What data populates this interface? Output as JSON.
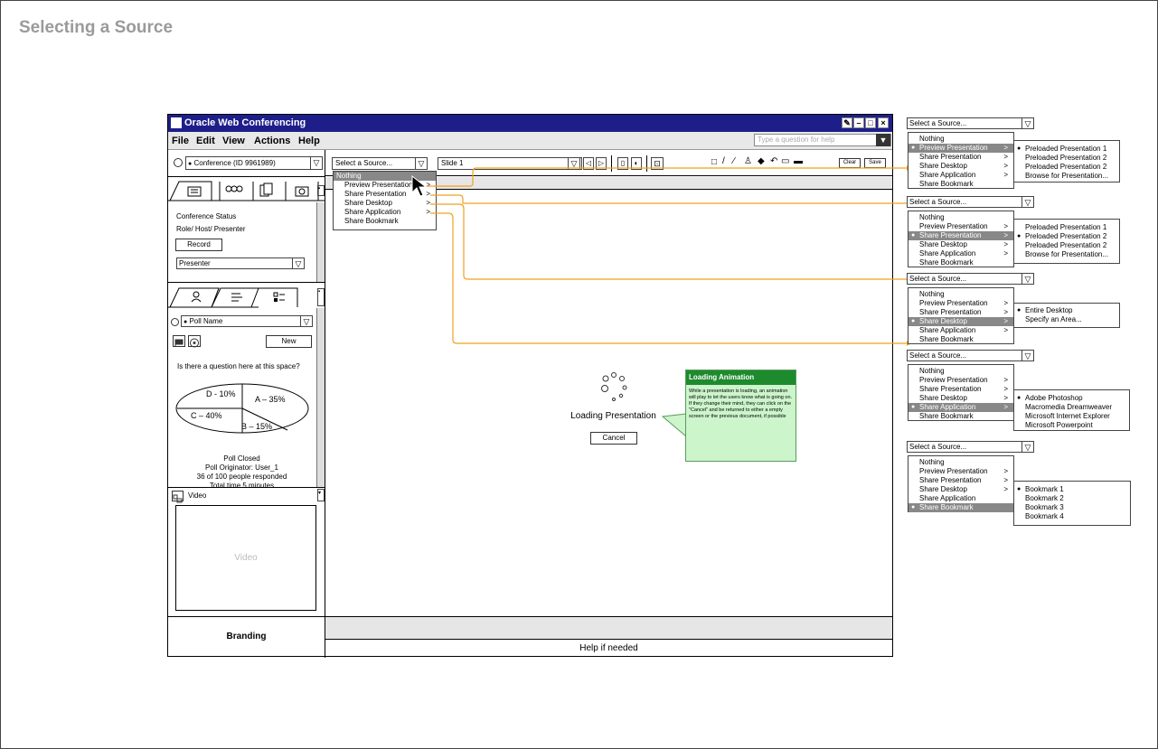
{
  "page": {
    "title": "Selecting a Source"
  },
  "window": {
    "title": "Oracle Web Conferencing",
    "menu": [
      "File",
      "Edit",
      "View",
      "Actions",
      "Help"
    ],
    "help_placeholder": "Type a question for help",
    "conference_combo": "Conference (ID 9961989)",
    "status": {
      "heading": "Conference Status",
      "role": "Role/ Host/ Presenter",
      "record_label": "Record",
      "role_combo": "Presenter"
    },
    "poll": {
      "name_combo": "Poll Name",
      "new_label": "New",
      "question": "Is there a question here at this space?",
      "slices": [
        {
          "label": "D - 10%",
          "value": 10
        },
        {
          "label": "A – 35%",
          "value": 35
        },
        {
          "label": "C – 40%",
          "value": 40
        },
        {
          "label": "B – 15%",
          "value": 15
        }
      ],
      "closed": "Poll Closed",
      "originator": "Poll Originator: User_1",
      "responded": "36 of 100 people responded",
      "total_time": "Total time 5 minutes"
    },
    "video": {
      "label": "Video",
      "placeholder": "Video"
    },
    "branding": "Branding",
    "help_footer": "Help if needed",
    "source_combo": "Select a Source...",
    "slide_combo": "Slide 1",
    "clear_label": "Clear",
    "save_label": "Save",
    "source_menu": [
      "Nothing",
      "Preview Presentation",
      "Share Presentation",
      "Share Desktop",
      "Share Application",
      "Share Bookmark"
    ],
    "source_menu_chevrons": [
      ">",
      ">",
      ">",
      ">"
    ],
    "loading": {
      "text": "Loading Presentation",
      "cancel_label": "Cancel",
      "callout_title": "Loading Animation",
      "callout_body": "While a presentation is loading, an animation will play to let the users know what is going on. If they change their mind, they can click on the \"Cancel\" and be returned to either a empty screen or the previous document, if possible"
    }
  },
  "side_panels": [
    {
      "combo": "Select a Source...",
      "items": [
        "Nothing",
        "Preview Presentation",
        "Share Presentation",
        "Share Desktop",
        "Share Application",
        "Share Bookmark"
      ],
      "chev": [
        ">",
        ">",
        ">",
        ">"
      ],
      "sub": [
        "Preloaded Presentation 1",
        "Preloaded Presentation 2",
        "Preloaded Presentation 2",
        "Browse for Presentation..."
      ]
    },
    {
      "combo": "Select a Source...",
      "items": [
        "Nothing",
        "Preview Presentation",
        "Share Presentation",
        "Share Desktop",
        "Share Application",
        "Share Bookmark"
      ],
      "chev": [
        ">",
        ">",
        ">",
        ">"
      ],
      "sub": [
        "Preloaded Presentation 1",
        "Preloaded Presentation 2",
        "Preloaded Presentation 2",
        "Browse for Presentation..."
      ]
    },
    {
      "combo": "Select a Source...",
      "items": [
        "Nothing",
        "Preview Presentation",
        "Share Presentation",
        "Share Desktop",
        "Share Application",
        "Share Bookmark"
      ],
      "chev": [
        ">",
        ">",
        ">",
        ">"
      ],
      "sub": [
        "Entire Desktop",
        "Specify an Area..."
      ]
    },
    {
      "combo": "Select a Source...",
      "items": [
        "Nothing",
        "Preview Presentation",
        "Share Presentation",
        "Share Desktop",
        "Share Application",
        "Share Bookmark"
      ],
      "chev": [
        ">",
        ">",
        ">",
        ">"
      ],
      "sub": [
        "Adobe Photoshop",
        "Macromedia Dreamweaver",
        "Microsoft Internet Explorer",
        "Microsoft Powerpoint"
      ]
    },
    {
      "combo": "Select a Source...",
      "items": [
        "Nothing",
        "Preview Presentation",
        "Share Presentation",
        "Share Desktop",
        "Share Application",
        "Share Bookmark"
      ],
      "chev": [
        ">",
        ">",
        ">"
      ],
      "sub": [
        "Bookmark 1",
        "Bookmark 2",
        "Bookmark 3",
        "Bookmark 4"
      ]
    }
  ],
  "colors": {
    "titlebar": "#1e1e8a",
    "connector": "#f0a020",
    "callout": "#ccf5cc",
    "callout_head": "#1e8a2e",
    "highlight": "#888888"
  }
}
